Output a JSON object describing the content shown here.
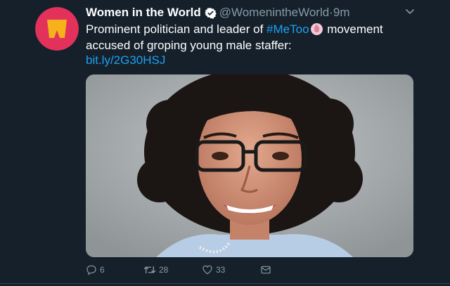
{
  "tweet": {
    "display_name": "Women in the World",
    "handle": "@WomenintheWorld",
    "separator": "·",
    "time": "9m",
    "text_before_hashtag": "Prominent politician and leader of ",
    "hashtag": "#MeToo",
    "text_after_hashtag": " movement accused of groping young male staffer:",
    "link": "bit.ly/2G30HSJ",
    "verified": true,
    "avatar_icon": "women-in-the-world-logo",
    "avatar_color": "#e2315a",
    "avatar_glyph_color": "#f7b21b"
  },
  "actions": {
    "reply_count": "6",
    "retweet_count": "28",
    "like_count": "33",
    "icons": {
      "reply": "reply-bubble-icon",
      "retweet": "retweet-icon",
      "like": "heart-icon",
      "dm": "envelope-icon",
      "menu": "chevron-down-icon"
    }
  },
  "colors": {
    "background": "#15202b",
    "primary_text": "#ffffff",
    "secondary_text": "#8899a6",
    "accent": "#1da1f2"
  }
}
